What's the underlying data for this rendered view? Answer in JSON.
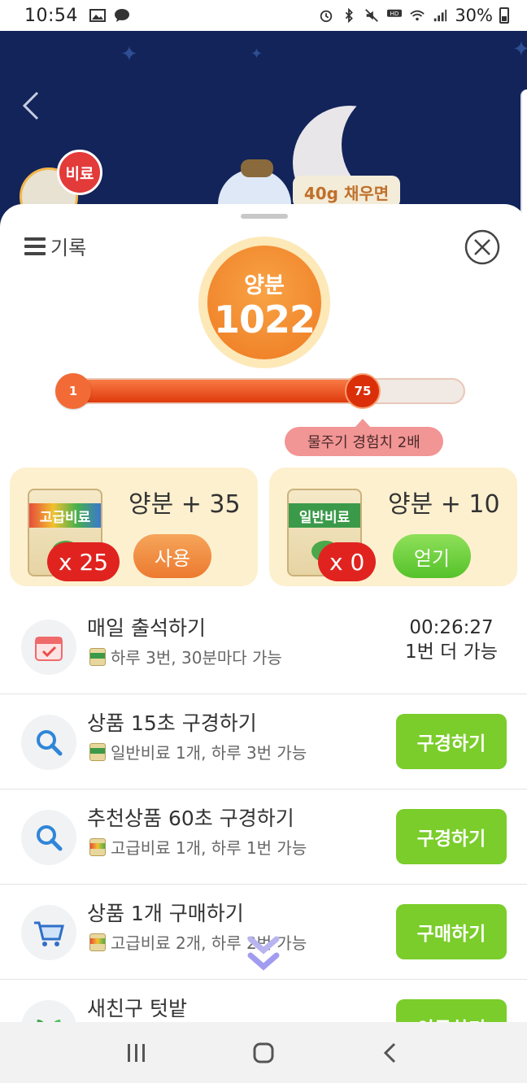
{
  "status_bar": {
    "time": "10:54",
    "battery": "30%",
    "left_icons": [
      "image-icon",
      "chat-icon"
    ],
    "right_icons": [
      "alarm-icon",
      "bluetooth-icon",
      "mute-icon",
      "hd-voice-icon",
      "wifi-icon",
      "signal-icon",
      "battery-icon"
    ]
  },
  "background": {
    "fertilizer_badge": "비료",
    "tip": "40g 채우면"
  },
  "sheet": {
    "history_label": "기록",
    "nutrient_label": "양분",
    "nutrient_value": "1022",
    "progress": {
      "start_label": "1",
      "current_label": "75",
      "fraction": 0.75
    },
    "bonus_tip": "물주기 경험치 2배",
    "cards": [
      {
        "bag_label": "고급비료",
        "count": "x 25",
        "reward": "양분 + 35",
        "action": "사용"
      },
      {
        "bag_label": "일반비료",
        "count": "x 0",
        "reward": "양분 + 10",
        "action": "얻기"
      }
    ],
    "tasks": [
      {
        "title": "매일 출석하기",
        "sub": "하루 3번, 30분마다 가능",
        "icon": "calendar-icon",
        "timer": "00:26:27",
        "timer_note": "1번 더 가능"
      },
      {
        "title": "상품 15초 구경하기",
        "sub": "일반비료 1개, 하루 3번 가능",
        "icon": "search-icon",
        "button": "구경하기"
      },
      {
        "title": "추천상품 60초 구경하기",
        "sub": "고급비료 1개, 하루 1번 가능",
        "icon": "search-icon",
        "button": "구경하기"
      },
      {
        "title": "상품 1개 구매하기",
        "sub": "고급비료 2개, 하루 2번 가능",
        "icon": "cart-icon",
        "button": "구매하기"
      },
      {
        "title": "새친구 텃밭",
        "sub": "",
        "icon": "leaf-icon",
        "button": "이동하기"
      }
    ]
  },
  "colors": {
    "night_sky": "#12245a",
    "orange": "#ee7a22",
    "green_button": "#7acd2a",
    "bonus_pink": "#f29595",
    "card_bg": "#fdf0cf"
  }
}
